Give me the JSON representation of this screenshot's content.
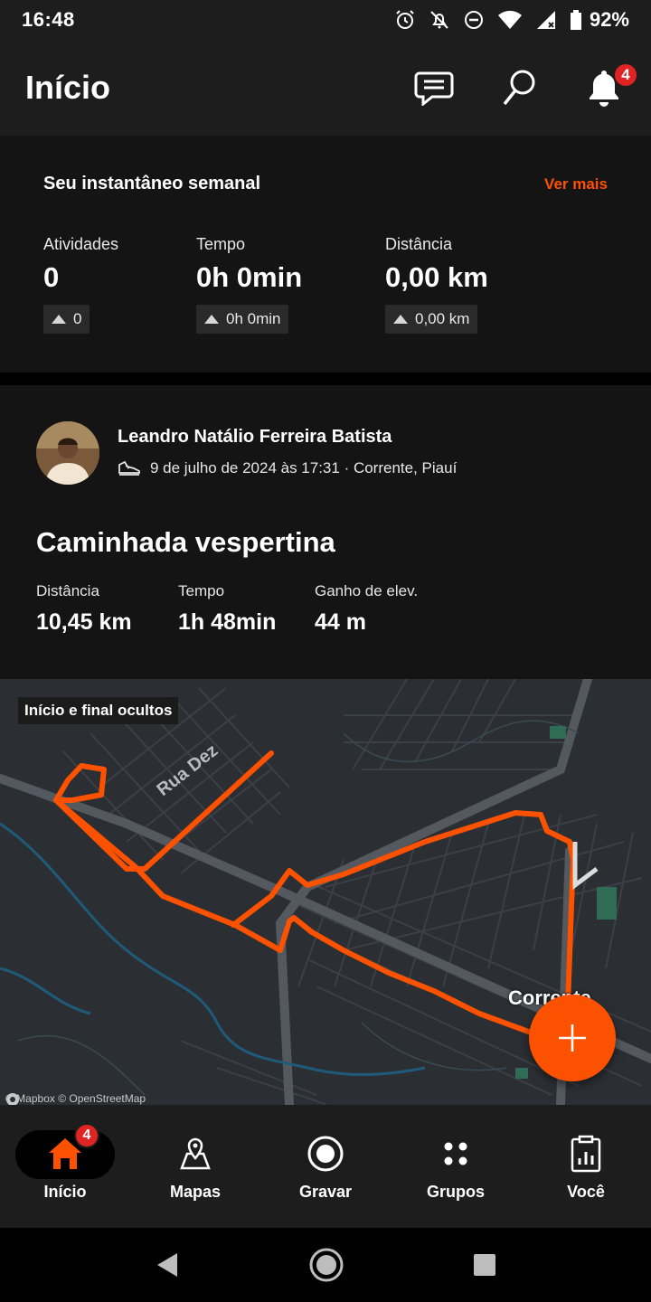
{
  "status_bar": {
    "time": "16:48",
    "battery": "92%"
  },
  "header": {
    "title": "Início",
    "notifications_count": "4"
  },
  "weekly": {
    "title": "Seu instantâneo semanal",
    "more_link": "Ver mais",
    "stats": [
      {
        "label": "Atividades",
        "value": "0",
        "delta": "0"
      },
      {
        "label": "Tempo",
        "value": "0h 0min",
        "delta": "0h 0min"
      },
      {
        "label": "Distância",
        "value": "0,00 km",
        "delta": "0,00 km"
      }
    ]
  },
  "activity": {
    "athlete": "Leandro Natálio Ferreira Batista",
    "meta": "9 de julho de 2024 às 17:31 · Corrente, Piauí",
    "title": "Caminhada vespertina",
    "stats": [
      {
        "label": "Distância",
        "value": "10,45 km"
      },
      {
        "label": "Tempo",
        "value": "1h 48min"
      },
      {
        "label": "Ganho de elev.",
        "value": "44 m"
      }
    ],
    "map": {
      "chip": "Início e final ocultos",
      "street_label": "Rua Dez",
      "city_label": "Corrente",
      "attribution": "© Mapbox © OpenStreetMap"
    }
  },
  "bottom_nav": {
    "items": [
      {
        "label": "Início",
        "badge": "4"
      },
      {
        "label": "Mapas"
      },
      {
        "label": "Gravar"
      },
      {
        "label": "Grupos"
      },
      {
        "label": "Você"
      }
    ]
  },
  "colors": {
    "accent": "#fc5200",
    "badge": "#e02424",
    "background": "#141414",
    "map_bg": "#2b2f33"
  }
}
